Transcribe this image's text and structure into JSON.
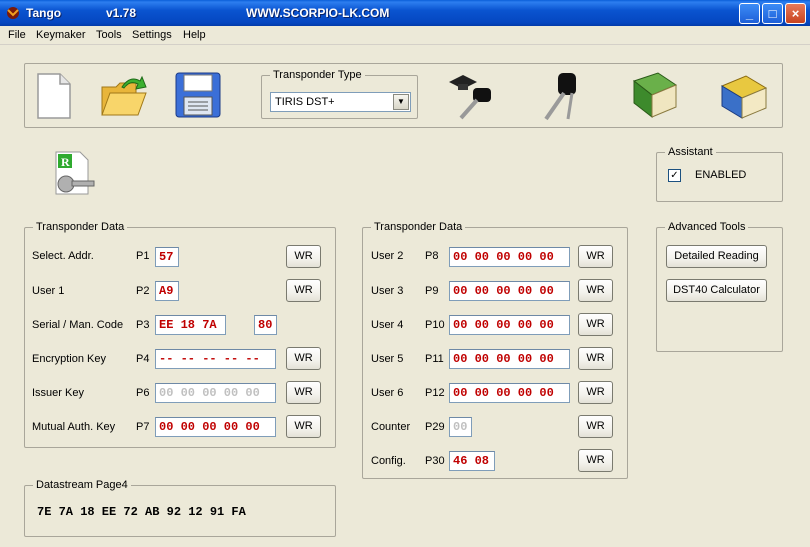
{
  "window": {
    "title": "Tango",
    "version": "v1.78",
    "website": "WWW.SCORPIO-LK.COM",
    "controls": {
      "minimize": "_",
      "maximize": "□",
      "close": "×"
    }
  },
  "menu": [
    "File",
    "Keymaker",
    "Tools",
    "Settings",
    "Help"
  ],
  "toolbar": {
    "transponder_type_label": "Transponder Type",
    "transponder_type_value": "TIRIS DST+",
    "icons": [
      "new-file-icon",
      "open-folder-icon",
      "save-disk-icon",
      "graduate-key-icon",
      "car-keys-icon",
      "green-book-icon",
      "books-icon"
    ]
  },
  "assistant": {
    "label": "Assistant",
    "checkbox_label": "ENABLED",
    "checked": true
  },
  "advanced_tools": {
    "label": "Advanced Tools",
    "detailed_reading": "Detailed Reading",
    "dst40_calculator": "DST40 Calculator"
  },
  "left_group": {
    "label": "Transponder Data",
    "rows": [
      {
        "name": "Select. Addr.",
        "page": "P1",
        "value": "57",
        "wr": "WR"
      },
      {
        "name": "User 1",
        "page": "P2",
        "value": "A9",
        "wr": "WR"
      },
      {
        "name": "Serial / Man. Code",
        "page": "P3",
        "value": "EE 18 7A",
        "value2": "80"
      },
      {
        "name": "Encryption Key",
        "page": "P4",
        "value": "-- -- -- -- --",
        "wr": "WR"
      },
      {
        "name": "Issuer Key",
        "page": "P6",
        "value": "00 00 00 00 00",
        "wr": "WR"
      },
      {
        "name": "Mutual Auth. Key",
        "page": "P7",
        "value": "00 00 00 00 00",
        "wr": "WR"
      }
    ]
  },
  "right_group": {
    "label": "Transponder Data",
    "rows": [
      {
        "name": "User 2",
        "page": "P8",
        "value": "00 00 00 00 00",
        "wr": "WR"
      },
      {
        "name": "User 3",
        "page": "P9",
        "value": "00 00 00 00 00",
        "wr": "WR"
      },
      {
        "name": "User 4",
        "page": "P10",
        "value": "00 00 00 00 00",
        "wr": "WR"
      },
      {
        "name": "User 5",
        "page": "P11",
        "value": "00 00 00 00 00",
        "wr": "WR"
      },
      {
        "name": "User 6",
        "page": "P12",
        "value": "00 00 00 00 00",
        "wr": "WR"
      },
      {
        "name": "Counter",
        "page": "P29",
        "value": "00",
        "wr": "WR"
      },
      {
        "name": "Config.",
        "page": "P30",
        "value": "46 08",
        "wr": "WR"
      }
    ]
  },
  "datastream": {
    "label": "Datastream Page4",
    "value": "7E 7A 18 EE 72 AB 92 12 91 FA"
  },
  "colors": {
    "titlebar": "#0a54d0",
    "field_text": "#c00000",
    "field_grey": "#c0c0c0",
    "background": "#ece9d8"
  }
}
